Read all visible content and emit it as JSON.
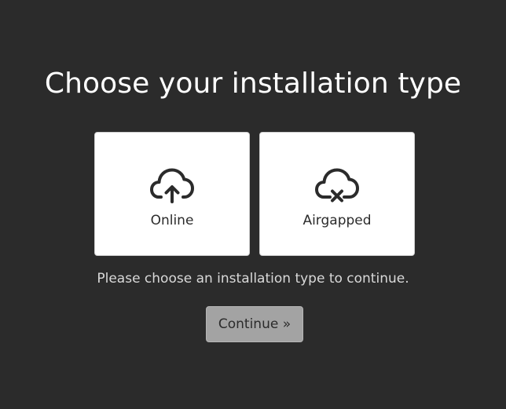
{
  "page": {
    "title": "Choose your installation type",
    "hint": "Please choose an installation type to continue."
  },
  "options": [
    {
      "label": "Online",
      "icon": "cloud-upload-icon"
    },
    {
      "label": "Airgapped",
      "icon": "cloud-offline-icon"
    }
  ],
  "actions": {
    "continue_label": "Continue »",
    "continue_enabled": false
  },
  "colors": {
    "background": "#2b2b2b",
    "card": "#ffffff",
    "button_disabled": "#a3a3a3"
  }
}
